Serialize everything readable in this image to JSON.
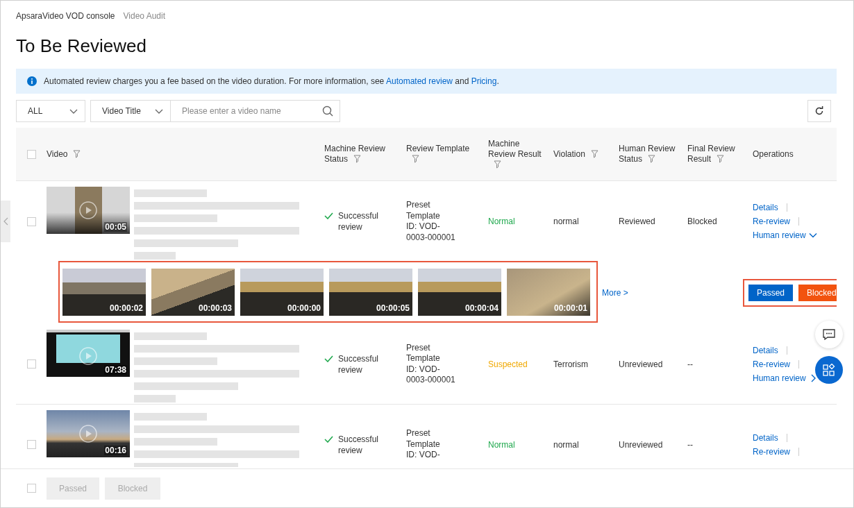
{
  "breadcrumb": [
    {
      "label": "ApsaraVideo VOD console",
      "current": false
    },
    {
      "label": "Video Audit",
      "current": true
    }
  ],
  "title": "To Be Reviewed",
  "notice": {
    "before": "Automated review charges you a fee based on the video duration. For more information, see ",
    "link_1": "Automated review",
    "middle": " and ",
    "link_2": "Pricing",
    "after": "."
  },
  "filters": {
    "scope": "ALL",
    "field": "Video Title",
    "search_placeholder": "Please enter a video name"
  },
  "table": {
    "select_all_checked": false,
    "columns": [
      {
        "label": "Video",
        "filter": true
      },
      {
        "label": "Machine Review Status",
        "filter": true
      },
      {
        "label": "Review Template",
        "filter": true
      },
      {
        "label": "Machine Review Result",
        "filter": true
      },
      {
        "label": "Violation",
        "filter": true
      },
      {
        "label": "Human Review Status",
        "filter": true
      },
      {
        "label": "Final Review Result",
        "filter": true
      },
      {
        "label": "Operations",
        "filter": false
      }
    ],
    "rows": [
      {
        "checked": false,
        "duration": "00:05",
        "machine_status": "Successful review",
        "template": [
          "Preset",
          "Template",
          "ID: VOD-",
          "0003-000001"
        ],
        "result": {
          "text": "Normal",
          "kind": "normal"
        },
        "violation": "normal",
        "human_status": "Reviewed",
        "final_result": "Blocked",
        "operations": [
          "Details",
          "Re-review",
          "Human review"
        ],
        "expanded": true,
        "frames": [
          {
            "time": "00:00:02"
          },
          {
            "time": "00:00:03"
          },
          {
            "time": "00:00:00"
          },
          {
            "time": "00:00:05"
          },
          {
            "time": "00:00:04"
          },
          {
            "time": "00:00:01"
          }
        ],
        "more": "More >",
        "actions": [
          {
            "label": "Passed",
            "kind": "pass"
          },
          {
            "label": "Blocked",
            "kind": "block"
          }
        ]
      },
      {
        "checked": false,
        "duration": "07:38",
        "machine_status": "Successful review",
        "template": [
          "Preset",
          "Template",
          "ID: VOD-",
          "0003-000001"
        ],
        "result": {
          "text": "Suspected",
          "kind": "suspected"
        },
        "violation": "Terrorism",
        "human_status": "Unreviewed",
        "final_result": "--",
        "operations": [
          "Details",
          "Re-review",
          "Human review"
        ],
        "expanded": false
      },
      {
        "checked": false,
        "duration": "00:16",
        "machine_status": "Successful review",
        "template": [
          "Preset",
          "Template",
          "ID: VOD-"
        ],
        "result": {
          "text": "Normal",
          "kind": "normal"
        },
        "violation": "normal",
        "human_status": "Unreviewed",
        "final_result": "--",
        "operations": [
          "Details",
          "Re-review"
        ]
      }
    ]
  },
  "footer": {
    "select_all_checked": false,
    "buttons": [
      {
        "label": "Passed",
        "disabled": true
      },
      {
        "label": "Blocked",
        "disabled": true
      }
    ]
  }
}
